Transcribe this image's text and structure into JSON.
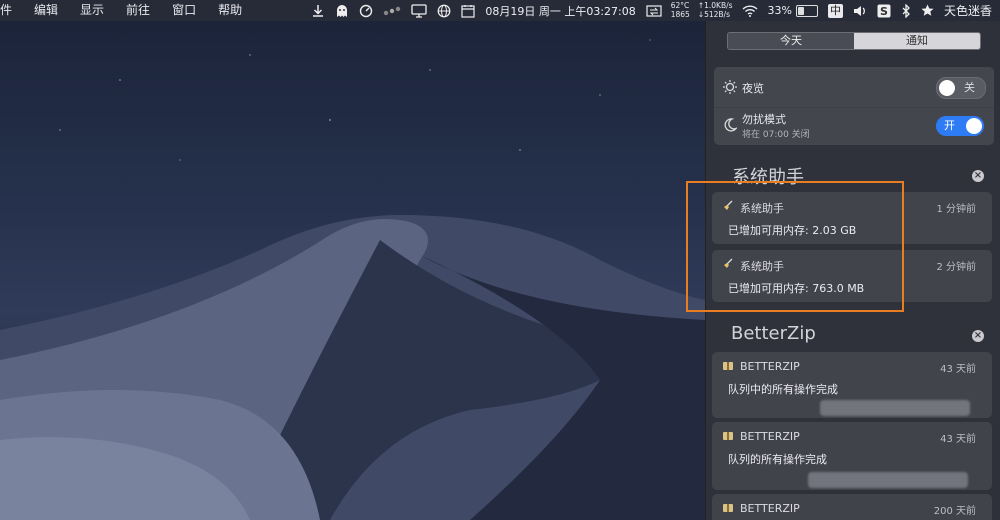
{
  "menubar": {
    "menus": [
      "件",
      "编辑",
      "显示",
      "前往",
      "窗口",
      "帮助"
    ],
    "stats": {
      "temp": "62°C",
      "fan": "1865",
      "up": "↑1.0KB/s",
      "down": "↓512B/s"
    },
    "datetime": "08月19日 周一 上午03:27:08",
    "battery": "33%",
    "battery_level": 0.33,
    "ime": "中",
    "user": "天色迷香"
  },
  "notification_center": {
    "tabs": [
      {
        "label": "今天",
        "active": false
      },
      {
        "label": "通知",
        "active": true
      }
    ],
    "controls": {
      "night_shift": {
        "label": "夜览",
        "state": "关"
      },
      "dnd": {
        "label": "勿扰模式",
        "sub": "将在 07:00 关闭",
        "state": "开"
      }
    },
    "groups": [
      {
        "title": "系统助手",
        "items": [
          {
            "app": "系统助手",
            "time": "1 分钟前",
            "body": "已增加可用内存: 2.03 GB"
          },
          {
            "app": "系统助手",
            "time": "2 分钟前",
            "body": "已增加可用内存: 763.0 MB"
          }
        ]
      },
      {
        "title": "BetterZip",
        "items": [
          {
            "app": "BETTERZIP",
            "time": "43 天前",
            "body": "队列中的所有操作完成"
          },
          {
            "app": "BETTERZIP",
            "time": "43 天前",
            "body": "队列的所有操作完成"
          },
          {
            "app": "BETTERZIP",
            "time": "200 天前",
            "body": ""
          }
        ]
      }
    ]
  },
  "colors": {
    "highlight": "#e87d22",
    "toggle_on": "#2d7cf6"
  }
}
